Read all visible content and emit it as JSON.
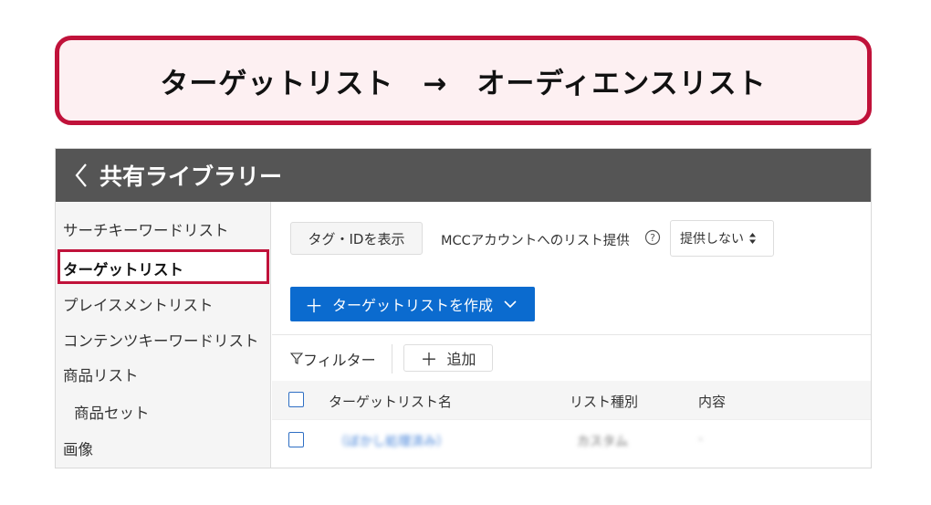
{
  "banner": {
    "text": "ターゲットリスト　→　オーディエンスリスト"
  },
  "header": {
    "title": "共有ライブラリー",
    "back_icon": "chevron-left-icon"
  },
  "sidebar": {
    "items": [
      {
        "label": "サーチキーワードリスト"
      },
      {
        "label": "ターゲットリスト",
        "active": true
      },
      {
        "label": "プレイスメントリスト"
      },
      {
        "label": "コンテンツキーワードリスト"
      },
      {
        "label": "商品リスト"
      },
      {
        "label": "商品セット"
      },
      {
        "label": "画像"
      }
    ]
  },
  "toolbar": {
    "tags_button": "タグ・IDを表示",
    "mcc_label": "MCCアカウントへのリスト提供",
    "help_icon": "question-circle-icon",
    "provide_select": "提供しない"
  },
  "create_button": {
    "label": "ターゲットリストを作成",
    "plus": "＋"
  },
  "filter": {
    "label": "フィルター",
    "add_label": "追加",
    "add_plus": "＋"
  },
  "table": {
    "columns": [
      "ターゲットリスト名",
      "リスト種別",
      "内容"
    ],
    "rows": [
      {
        "name": "（ぼかし処理済み）",
        "type": "カスタム",
        "content": "-"
      }
    ]
  },
  "colors": {
    "accent_red": "#c0123a",
    "header_bg": "#555555",
    "primary_blue": "#0b6bcf",
    "banner_bg": "#fdf0f2"
  }
}
